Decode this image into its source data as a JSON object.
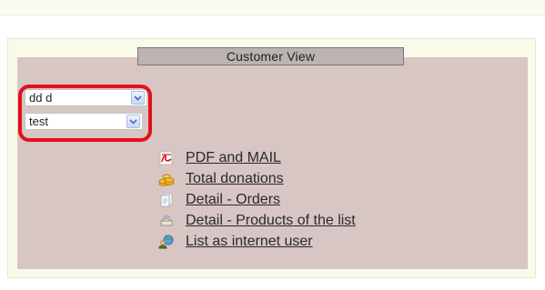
{
  "panel": {
    "title": "Customer View"
  },
  "selects": [
    {
      "value": "dd d"
    },
    {
      "value": "test"
    }
  ],
  "links": [
    {
      "label": "PDF and MAIL",
      "icon": "pdf-icon"
    },
    {
      "label": "Total donations",
      "icon": "donations-icon"
    },
    {
      "label": "Detail - Orders",
      "icon": "orders-icon"
    },
    {
      "label": "Detail - Products of the list",
      "icon": "products-icon"
    },
    {
      "label": "List as internet user",
      "icon": "internet-user-icon"
    }
  ],
  "colors": {
    "panel_bg": "#d7c6c4",
    "highlight": "#e3111c",
    "title_bar": "#bab3b1"
  }
}
